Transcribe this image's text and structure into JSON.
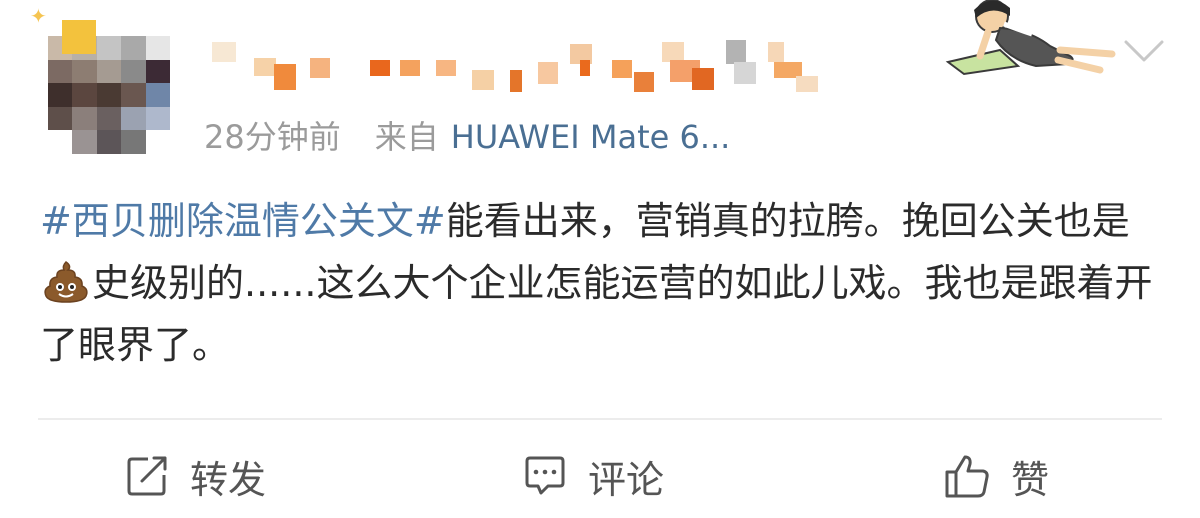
{
  "post": {
    "time": "28分钟前",
    "source_prefix": "来自",
    "device": "HUAWEI Mate 6...",
    "topic": "#西贝删除温情公关文#",
    "text_1": "能看出来，营销真的拉胯。挽回公关也是",
    "emoji": "poop-emoji",
    "text_2": "史级别的......这么大个企业怎能运营的如此儿戏。我也是跟着开了眼界了。"
  },
  "actions": {
    "repost": "转发",
    "comment": "评论",
    "like": "赞"
  },
  "colors": {
    "topic_link": "#4f7aa7",
    "meta": "#9b9b9b",
    "device_link": "#4a6f93",
    "action_text": "#555555"
  }
}
